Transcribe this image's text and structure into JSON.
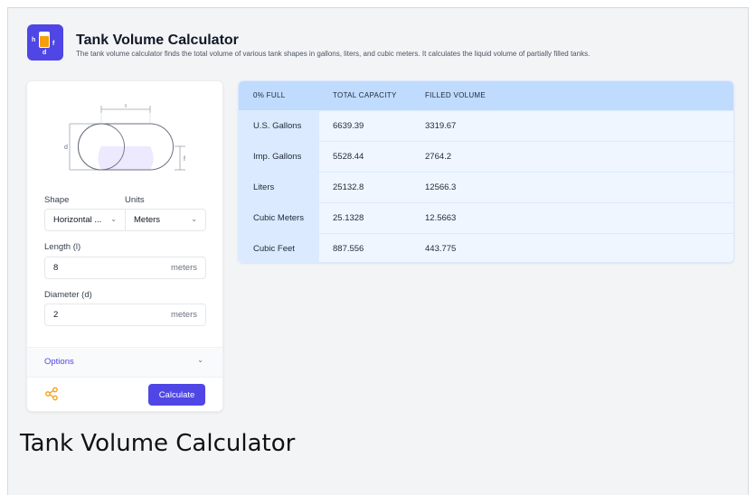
{
  "app": {
    "title": "Tank Volume Calculator",
    "subtitle": "The tank volume calculator finds the total volume of various tank shapes in gallons, liters, and cubic meters. It calculates the liquid volume of partially filled tanks.",
    "icon_labels": {
      "h": "h",
      "f": "f",
      "d": "d"
    }
  },
  "diagram": {
    "length_label": "l",
    "diameter_label": "d",
    "fill_label": "f"
  },
  "form": {
    "shape_label": "Shape",
    "shape_value": "Horizontal ...",
    "units_label": "Units",
    "units_value": "Meters",
    "length_label": "Length (l)",
    "length_value": "8",
    "length_unit": "meters",
    "diameter_label": "Diameter (d)",
    "diameter_value": "2",
    "diameter_unit": "meters",
    "options_label": "Options",
    "calculate_label": "Calculate"
  },
  "results": {
    "headers": [
      "0% FULL",
      "TOTAL CAPACITY",
      "FILLED VOLUME"
    ],
    "rows": [
      {
        "unit": "U.S. Gallons",
        "total": "6639.39",
        "filled": "3319.67"
      },
      {
        "unit": "Imp. Gallons",
        "total": "5528.44",
        "filled": "2764.2"
      },
      {
        "unit": "Liters",
        "total": "25132.8",
        "filled": "12566.3"
      },
      {
        "unit": "Cubic Meters",
        "total": "25.1328",
        "filled": "12.5663"
      },
      {
        "unit": "Cubic Feet",
        "total": "887.556",
        "filled": "443.775"
      }
    ]
  },
  "caption": "Tank Volume Calculator",
  "colors": {
    "accent": "#4f46e5",
    "liquid": "#f59e0b",
    "table_header": "#bfdbfe"
  }
}
